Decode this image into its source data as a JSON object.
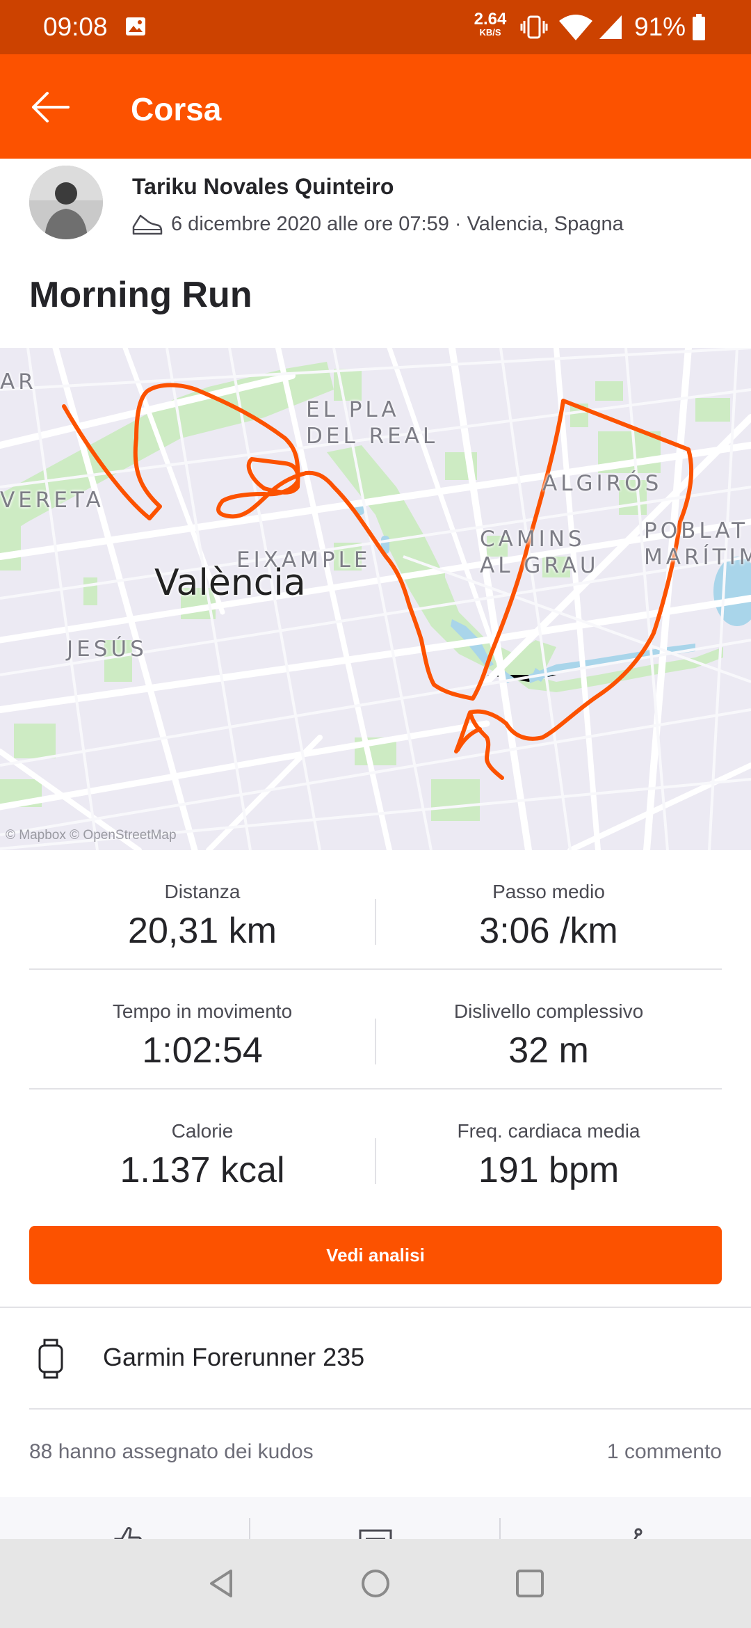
{
  "status_bar": {
    "time": "09:08",
    "network_speed_value": "2.64",
    "network_speed_unit": "KB/S",
    "battery": "91%"
  },
  "app_bar": {
    "title": "Corsa"
  },
  "activity": {
    "athlete": "Tariku Novales Quinteiro",
    "meta": "6 dicembre 2020 alle ore 07:59 · Valencia, Spagna",
    "title": "Morning Run"
  },
  "map": {
    "city": "València",
    "labels": {
      "pla": "EL PLA\nDEL REAL",
      "algiros": "ALGIRÓS",
      "camins": "CAMINS\nAL GRAU",
      "poblat": "POBLAT\nMARÍTIM",
      "eixample": "EIXAMPLE",
      "jesus": "JESÚS",
      "ereta": "VERETA",
      "ar": "AR"
    },
    "attribution": "© Mapbox © OpenStreetMap",
    "route_color": "#fc5200"
  },
  "stats": [
    {
      "label": "Distanza",
      "value": "20,31 km"
    },
    {
      "label": "Passo medio",
      "value": "3:06 /km"
    },
    {
      "label": "Tempo in movimento",
      "value": "1:02:54"
    },
    {
      "label": "Dislivello complessivo",
      "value": "32 m"
    },
    {
      "label": "Calorie",
      "value": "1.137 kcal"
    },
    {
      "label": "Freq. cardiaca media",
      "value": "191 bpm"
    }
  ],
  "analysis_button": "Vedi analisi",
  "device": "Garmin Forerunner 235",
  "social": {
    "kudos": "88 hanno assegnato dei kudos",
    "comments": "1 commento"
  },
  "colors": {
    "brand": "#fc5200",
    "status_bar": "#cc4200"
  }
}
